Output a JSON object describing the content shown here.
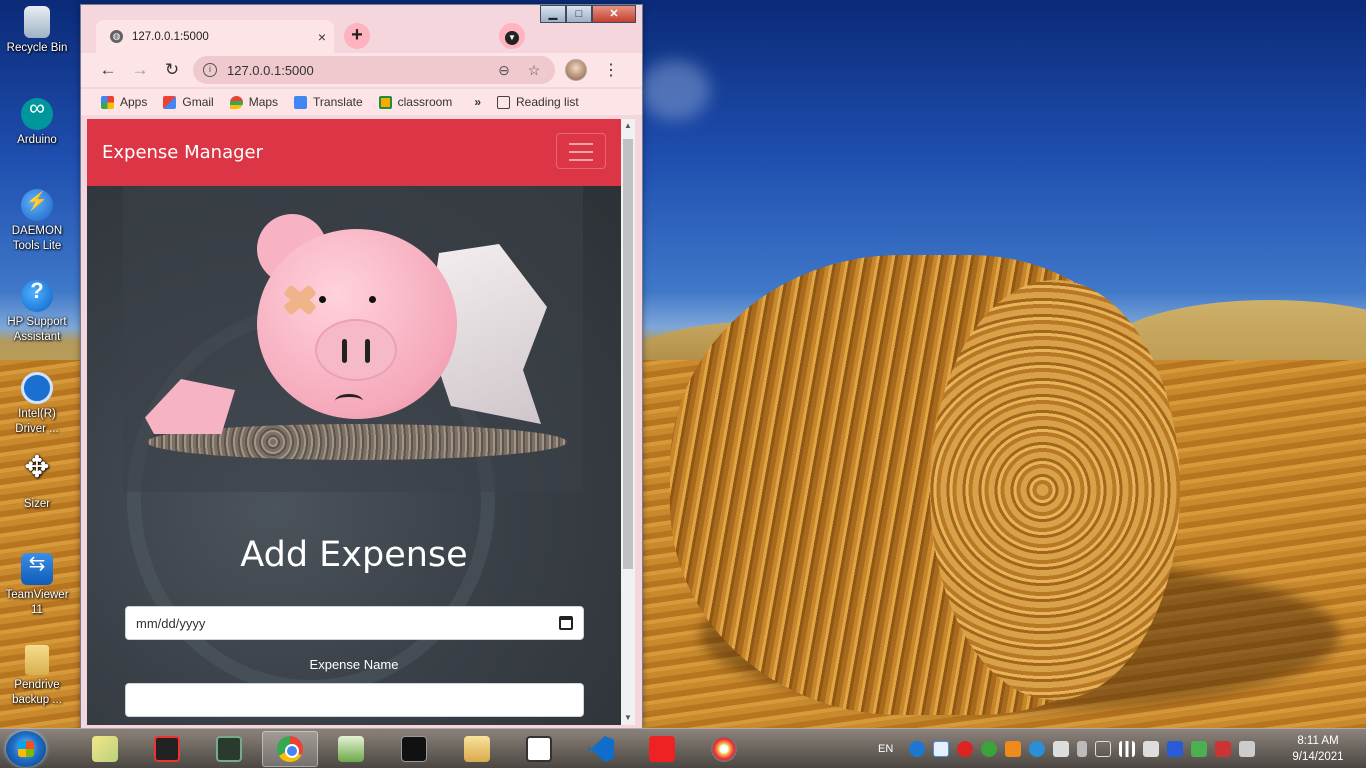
{
  "desktop": {
    "icons": [
      {
        "label": "Recycle Bin",
        "icon": "recycle-bin-icon"
      },
      {
        "label": "Arduino",
        "icon": "arduino-icon"
      },
      {
        "label": "DAEMON Tools Lite",
        "icon": "daemon-tools-icon"
      },
      {
        "label": "HP Support Assistant",
        "icon": "hp-support-icon"
      },
      {
        "label": "Intel(R) Driver ...",
        "icon": "intel-driver-icon"
      },
      {
        "label": "Sizer",
        "icon": "sizer-icon"
      },
      {
        "label": "TeamViewer 11",
        "icon": "teamviewer-icon"
      },
      {
        "label": "Pendrive backup ...",
        "icon": "folder-icon"
      }
    ]
  },
  "browser": {
    "tab": {
      "title": "127.0.0.1:5000",
      "close": "×"
    },
    "new_tab": "+",
    "address": {
      "url": "127.0.0.1:5000"
    },
    "bookmarks": [
      {
        "label": "Apps",
        "icon": "apps-grid-icon"
      },
      {
        "label": "Gmail",
        "icon": "gmail-icon"
      },
      {
        "label": "Maps",
        "icon": "maps-pin-icon"
      },
      {
        "label": "Translate",
        "icon": "translate-icon"
      },
      {
        "label": "classroom",
        "icon": "classroom-icon"
      }
    ],
    "bookmarks_more": "»",
    "reading_list": "Reading list"
  },
  "page": {
    "brand": "Expense Manager",
    "heading": "Add Expense",
    "date_placeholder": "mm/dd/yyyy",
    "expense_name_label": "Expense Name",
    "expense_name_value": ""
  },
  "taskbar": {
    "apps": [
      {
        "name": "Sticky Notes",
        "icon": "sticky-notes-icon"
      },
      {
        "name": "MS Office",
        "icon": "ms-office-icon"
      },
      {
        "name": "System Monitor",
        "icon": "monitor-icon"
      },
      {
        "name": "Google Chrome",
        "icon": "chrome-icon",
        "active": true
      },
      {
        "name": "Notepad++",
        "icon": "notepad-plus-icon"
      },
      {
        "name": "Command Prompt",
        "icon": "cmd-icon"
      },
      {
        "name": "File Explorer",
        "icon": "explorer-icon"
      },
      {
        "name": "321 Player",
        "icon": "player-321-icon"
      },
      {
        "name": "Visual Studio Code",
        "icon": "vscode-icon"
      },
      {
        "name": "VLC",
        "icon": "vlc-icon"
      },
      {
        "name": "Paint",
        "icon": "paint-icon"
      }
    ],
    "language": "EN",
    "time": "8:11 AM",
    "date": "9/14/2021"
  }
}
